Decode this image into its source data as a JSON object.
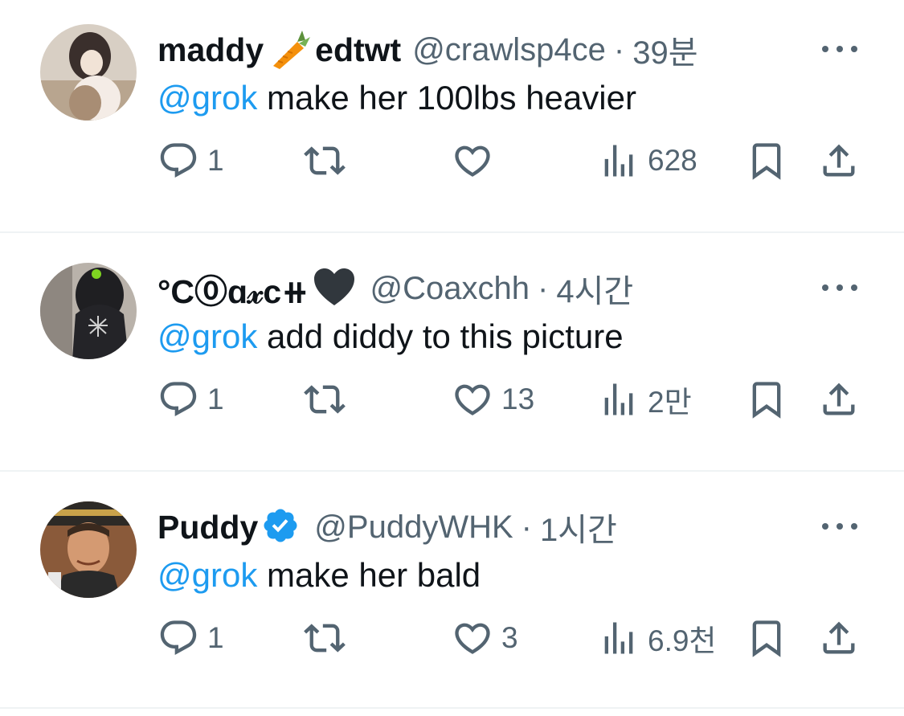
{
  "colors": {
    "accent": "#1d9bf0",
    "muted": "#536471",
    "text": "#0f1419",
    "divider": "#eff3f4"
  },
  "tweets": [
    {
      "name_part1": "maddy",
      "name_emoji": "carrot-emoji",
      "name_part2": "edtwt",
      "handle": "@crawlsp4ce",
      "sep": "·",
      "time": "39분",
      "mention": "@grok",
      "text": " make her 100lbs heavier",
      "replies": "1",
      "reposts": "",
      "likes": "",
      "views": "628",
      "verified": false
    },
    {
      "name_part1": "°C⓪ɑ𝓍c⧺",
      "name_emoji": "black-heart-emoji",
      "name_part2": "",
      "handle": "@Coaxchh",
      "sep": "·",
      "time": "4시간",
      "mention": "@grok",
      "text": " add diddy to this picture",
      "replies": "1",
      "reposts": "",
      "likes": "13",
      "views": "2만",
      "verified": false
    },
    {
      "name_part1": "Puddy",
      "name_emoji": "",
      "name_part2": "",
      "handle": "@PuddyWHK",
      "sep": "·",
      "time": "1시간",
      "mention": "@grok",
      "text": " make her bald",
      "replies": "1",
      "reposts": "",
      "likes": "3",
      "views": "6.9천",
      "verified": true
    }
  ]
}
